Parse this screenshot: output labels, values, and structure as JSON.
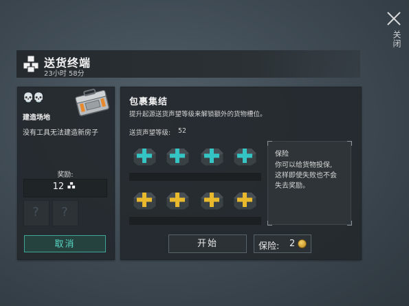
{
  "top": {
    "close_label": "关闭"
  },
  "header": {
    "title": "送货终端",
    "subtitle": "23小时 58分"
  },
  "left": {
    "skulls": "💀💀",
    "site_label": "建造场地",
    "description": "没有工具无法建造新房子",
    "reward_label": "奖励:",
    "reward_value": "12",
    "unknown_slots": [
      "?",
      "?"
    ],
    "cancel_label": "取消"
  },
  "right": {
    "title": "包裹集结",
    "description": "提升起源送货声望等级来解锁额外的货物槽位。",
    "reputation_label": "送货声望等级:",
    "reputation_value": "52",
    "slots_row1_color": "#34c4c4",
    "slots_row2_color": "#e8b92c"
  },
  "insurance": {
    "title": "保险",
    "lines": [
      "你可以给货物投保,",
      "这样即使失败也不会",
      "失去奖励。"
    ]
  },
  "buttons": {
    "start_label": "开始",
    "insurance_label": "保险:",
    "insurance_value": "2"
  }
}
